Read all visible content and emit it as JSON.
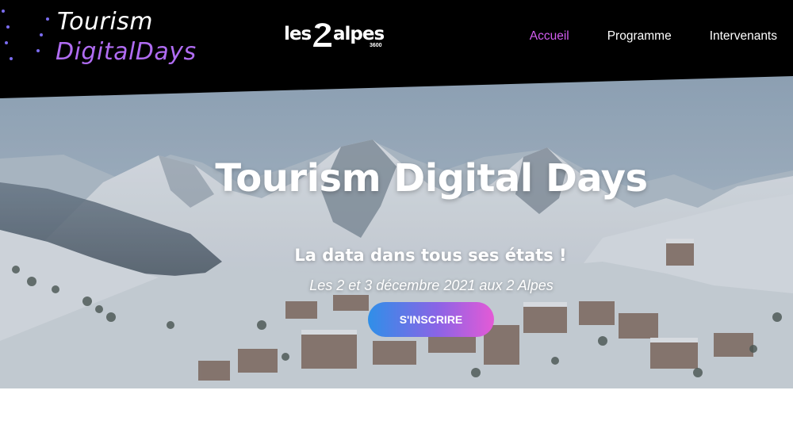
{
  "brand": {
    "logo_line1": "Tourism",
    "logo_line2": "DigitalDays",
    "logo_colors": [
      "#5a7cf0",
      "#9a5ef0",
      "#d25df0",
      "#3ec0f0"
    ]
  },
  "partner": {
    "les": "les",
    "alpes": "alpes",
    "sub": "3600"
  },
  "nav": {
    "items": [
      {
        "label": "Accueil",
        "active": true
      },
      {
        "label": "Programme",
        "active": false
      },
      {
        "label": "Intervenants",
        "active": false
      }
    ],
    "active_color": "#d25df0"
  },
  "hero": {
    "title": "Tourism Digital Days",
    "subtitle": "La data dans tous ses états !",
    "date": "Les 2 et 3 décembre 2021 aux 2 Alpes",
    "cta_label": "S'INSCRIRE",
    "cta_gradient": [
      "#2f8fe8",
      "#8a64e6",
      "#e45ad6"
    ]
  }
}
